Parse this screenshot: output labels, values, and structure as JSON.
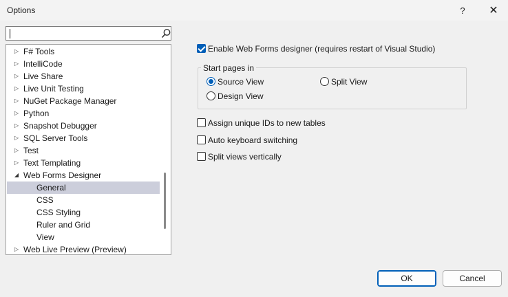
{
  "window": {
    "title": "Options",
    "help_glyph": "?",
    "close_glyph": "✕"
  },
  "search": {
    "value": "",
    "placeholder": ""
  },
  "tree": {
    "items": [
      {
        "label": "F# Tools",
        "expander": "▷"
      },
      {
        "label": "IntelliCode",
        "expander": "▷"
      },
      {
        "label": "Live Share",
        "expander": "▷"
      },
      {
        "label": "Live Unit Testing",
        "expander": "▷"
      },
      {
        "label": "NuGet Package Manager",
        "expander": "▷"
      },
      {
        "label": "Python",
        "expander": "▷"
      },
      {
        "label": "Snapshot Debugger",
        "expander": "▷"
      },
      {
        "label": "SQL Server Tools",
        "expander": "▷"
      },
      {
        "label": "Test",
        "expander": "▷"
      },
      {
        "label": "Text Templating",
        "expander": "▷"
      },
      {
        "label": "Web Forms Designer",
        "expander": "◢"
      },
      {
        "label": "General",
        "selected": true
      },
      {
        "label": "CSS"
      },
      {
        "label": "CSS Styling"
      },
      {
        "label": "Ruler and Grid"
      },
      {
        "label": "View"
      },
      {
        "label": "Web Live Preview (Preview)",
        "expander": "▷"
      }
    ]
  },
  "settings": {
    "enable_designer": {
      "label": "Enable Web Forms designer (requires restart of Visual Studio)",
      "checked": true
    },
    "start_pages": {
      "title": "Start pages in",
      "source_view": {
        "label": "Source View",
        "selected": true
      },
      "split_view": {
        "label": "Split View",
        "selected": false
      },
      "design_view": {
        "label": "Design View",
        "selected": false
      }
    },
    "unique_ids": {
      "label": "Assign unique IDs to new tables",
      "checked": false
    },
    "auto_keyboard": {
      "label": "Auto keyboard switching",
      "checked": false
    },
    "split_vertical": {
      "label": "Split views vertically",
      "checked": false
    }
  },
  "buttons": {
    "ok": "OK",
    "cancel": "Cancel"
  },
  "colors": {
    "accent": "#005fb8",
    "selection": "#cccedb"
  }
}
